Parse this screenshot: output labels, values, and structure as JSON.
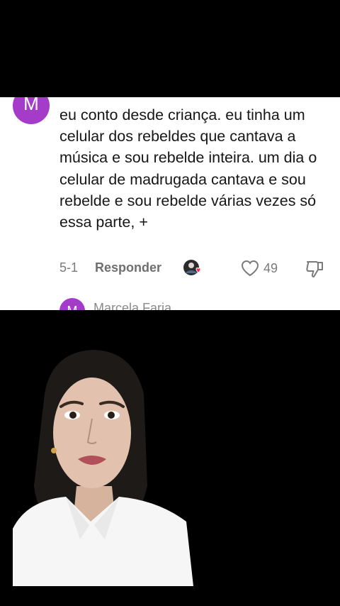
{
  "comment": {
    "avatar_letter": "M",
    "text": "eu conto desde criança. eu tinha um celular dos rebeldes que cantava a música e sou rebelde inteira. um dia o celular de madrugada cantava e sou rebelde e sou rebelde várias vezes só essa parte, +",
    "date": "5-1",
    "reply_label": "Responder",
    "like_count": "49"
  },
  "next_comment": {
    "avatar_letter": "M",
    "author": "Marcela Faria"
  },
  "colors": {
    "avatar": "#a53cc9",
    "like_heart": "#fe2c55",
    "background": "#000000",
    "card": "#ffffff"
  },
  "icons": {
    "like": "heart-outline-icon",
    "dislike": "thumbs-down-icon",
    "creator_liked": "creator-liked-badge-icon"
  }
}
